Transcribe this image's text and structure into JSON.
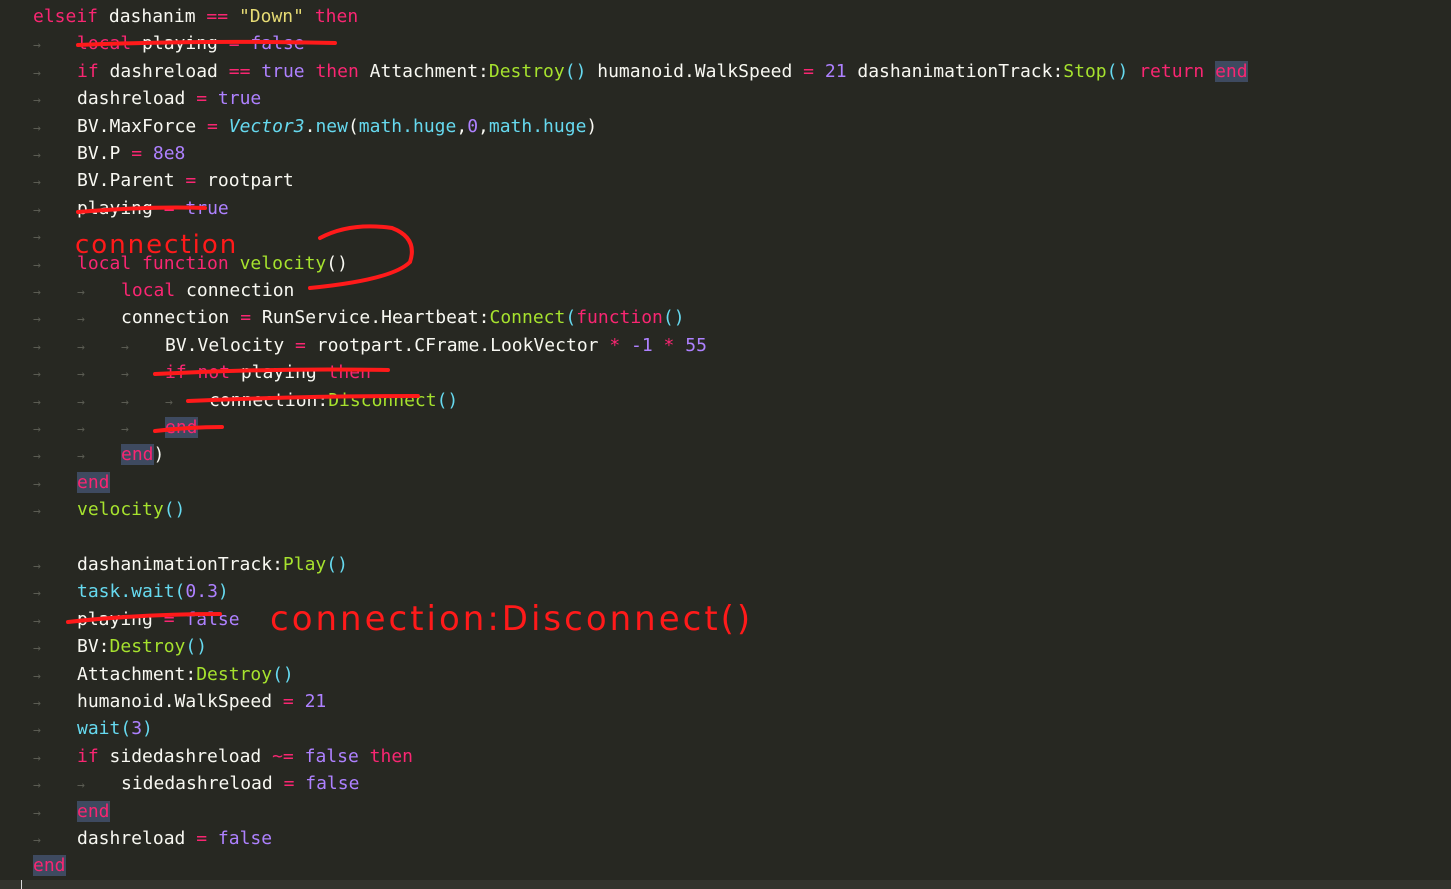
{
  "colors": {
    "background": "#272822",
    "default": "#f8f8f2",
    "keyword": "#f92672",
    "builtin": "#66d9ef",
    "function": "#a6e22e",
    "string": "#e6db74",
    "constant": "#ae81ff",
    "annotation": "#ff1a1a"
  },
  "lines": [
    {
      "indent": 0,
      "tokens": [
        [
          "elseif",
          "keyword"
        ],
        [
          " dashanim ",
          "default"
        ],
        [
          "==",
          "keyword"
        ],
        [
          " ",
          "default"
        ],
        [
          "\"Down\"",
          "string"
        ],
        [
          " ",
          "default"
        ],
        [
          "then",
          "keyword"
        ]
      ]
    },
    {
      "indent": 1,
      "tokens": [
        [
          "local",
          "keyword"
        ],
        [
          " playing ",
          "default"
        ],
        [
          "=",
          "keyword"
        ],
        [
          " ",
          "default"
        ],
        [
          "false",
          "constant"
        ]
      ]
    },
    {
      "indent": 1,
      "tokens": [
        [
          "if",
          "keyword"
        ],
        [
          " dashreload ",
          "default"
        ],
        [
          "==",
          "keyword"
        ],
        [
          " ",
          "default"
        ],
        [
          "true",
          "constant"
        ],
        [
          " ",
          "default"
        ],
        [
          "then",
          "keyword"
        ],
        [
          " Attachment:",
          "default"
        ],
        [
          "Destroy",
          "function"
        ],
        [
          "()",
          "builtin"
        ],
        [
          " humanoid.WalkSpeed ",
          "default"
        ],
        [
          "=",
          "keyword"
        ],
        [
          " ",
          "default"
        ],
        [
          "21",
          "constant"
        ],
        [
          " dashanimationTrack:",
          "default"
        ],
        [
          "Stop",
          "function"
        ],
        [
          "()",
          "builtin"
        ],
        [
          " ",
          "default"
        ],
        [
          "return",
          "keyword"
        ],
        [
          " ",
          "default"
        ],
        [
          "end",
          "keyword_hl"
        ]
      ]
    },
    {
      "indent": 1,
      "tokens": [
        [
          "dashreload ",
          "default"
        ],
        [
          "=",
          "keyword"
        ],
        [
          " ",
          "default"
        ],
        [
          "true",
          "constant"
        ]
      ]
    },
    {
      "indent": 1,
      "tokens": [
        [
          "BV.MaxForce ",
          "default"
        ],
        [
          "=",
          "keyword"
        ],
        [
          " ",
          "default"
        ],
        [
          "Vector3",
          "builtin_italic"
        ],
        [
          ".",
          "default"
        ],
        [
          "new",
          "builtin"
        ],
        [
          "(",
          "default"
        ],
        [
          "math.huge",
          "builtin"
        ],
        [
          ",",
          "default"
        ],
        [
          "0",
          "constant"
        ],
        [
          ",",
          "default"
        ],
        [
          "math.huge",
          "builtin"
        ],
        [
          ")",
          "default"
        ]
      ]
    },
    {
      "indent": 1,
      "tokens": [
        [
          "BV.P ",
          "default"
        ],
        [
          "=",
          "keyword"
        ],
        [
          " ",
          "default"
        ],
        [
          "8e8",
          "constant"
        ]
      ]
    },
    {
      "indent": 1,
      "tokens": [
        [
          "BV.Parent ",
          "default"
        ],
        [
          "=",
          "keyword"
        ],
        [
          " rootpart",
          "default"
        ]
      ]
    },
    {
      "indent": 1,
      "tokens": [
        [
          "playing ",
          "default"
        ],
        [
          "=",
          "keyword"
        ],
        [
          " ",
          "default"
        ],
        [
          "true",
          "constant"
        ]
      ]
    },
    {
      "indent": 1,
      "tokens": []
    },
    {
      "indent": 1,
      "tokens": [
        [
          "local",
          "keyword"
        ],
        [
          " ",
          "default"
        ],
        [
          "function",
          "keyword"
        ],
        [
          " ",
          "default"
        ],
        [
          "velocity",
          "function"
        ],
        [
          "()",
          "default"
        ]
      ]
    },
    {
      "indent": 2,
      "tokens": [
        [
          "local",
          "keyword"
        ],
        [
          " connection",
          "default"
        ]
      ]
    },
    {
      "indent": 2,
      "tokens": [
        [
          "connection ",
          "default"
        ],
        [
          "=",
          "keyword"
        ],
        [
          " RunService.Heartbeat:",
          "default"
        ],
        [
          "Connect",
          "function"
        ],
        [
          "(",
          "builtin"
        ],
        [
          "function",
          "keyword"
        ],
        [
          "()",
          "builtin"
        ]
      ]
    },
    {
      "indent": 3,
      "tokens": [
        [
          "BV.Velocity ",
          "default"
        ],
        [
          "=",
          "keyword"
        ],
        [
          " rootpart.CFrame.LookVector ",
          "default"
        ],
        [
          "*",
          "keyword"
        ],
        [
          " ",
          "default"
        ],
        [
          "-1",
          "constant"
        ],
        [
          " ",
          "default"
        ],
        [
          "*",
          "keyword"
        ],
        [
          " ",
          "default"
        ],
        [
          "55",
          "constant"
        ]
      ]
    },
    {
      "indent": 3,
      "tokens": [
        [
          "if",
          "keyword"
        ],
        [
          " ",
          "default"
        ],
        [
          "not",
          "keyword"
        ],
        [
          " playing ",
          "default"
        ],
        [
          "then",
          "keyword"
        ]
      ]
    },
    {
      "indent": 4,
      "tokens": [
        [
          "connection:",
          "default"
        ],
        [
          "Disconnect",
          "function"
        ],
        [
          "()",
          "builtin"
        ]
      ]
    },
    {
      "indent": 3,
      "tokens": [
        [
          "end",
          "keyword_hl"
        ]
      ]
    },
    {
      "indent": 2,
      "tokens": [
        [
          "end",
          "keyword_hl"
        ],
        [
          ")",
          "default"
        ]
      ]
    },
    {
      "indent": 1,
      "tokens": [
        [
          "end",
          "keyword_hl"
        ]
      ]
    },
    {
      "indent": 1,
      "tokens": [
        [
          "velocity",
          "function"
        ],
        [
          "()",
          "builtin"
        ]
      ]
    },
    {
      "indent": 0,
      "tokens": []
    },
    {
      "indent": 1,
      "tokens": [
        [
          "dashanimationTrack:",
          "default"
        ],
        [
          "Play",
          "function"
        ],
        [
          "()",
          "builtin"
        ]
      ]
    },
    {
      "indent": 1,
      "tokens": [
        [
          "task.wait",
          "builtin"
        ],
        [
          "(",
          "builtin"
        ],
        [
          "0.3",
          "constant"
        ],
        [
          ")",
          "builtin"
        ]
      ]
    },
    {
      "indent": 1,
      "tokens": [
        [
          "playing ",
          "default"
        ],
        [
          "=",
          "keyword"
        ],
        [
          " ",
          "default"
        ],
        [
          "false",
          "constant"
        ]
      ]
    },
    {
      "indent": 1,
      "tokens": [
        [
          "BV:",
          "default"
        ],
        [
          "Destroy",
          "function"
        ],
        [
          "()",
          "builtin"
        ]
      ]
    },
    {
      "indent": 1,
      "tokens": [
        [
          "Attachment:",
          "default"
        ],
        [
          "Destroy",
          "function"
        ],
        [
          "()",
          "builtin"
        ]
      ]
    },
    {
      "indent": 1,
      "tokens": [
        [
          "humanoid.WalkSpeed ",
          "default"
        ],
        [
          "=",
          "keyword"
        ],
        [
          " ",
          "default"
        ],
        [
          "21",
          "constant"
        ]
      ]
    },
    {
      "indent": 1,
      "tokens": [
        [
          "wait",
          "builtin"
        ],
        [
          "(",
          "builtin"
        ],
        [
          "3",
          "constant"
        ],
        [
          ")",
          "builtin"
        ]
      ]
    },
    {
      "indent": 1,
      "tokens": [
        [
          "if",
          "keyword"
        ],
        [
          " sidedashreload ",
          "default"
        ],
        [
          "~=",
          "keyword"
        ],
        [
          " ",
          "default"
        ],
        [
          "false",
          "constant"
        ],
        [
          " ",
          "default"
        ],
        [
          "then",
          "keyword"
        ]
      ]
    },
    {
      "indent": 2,
      "tokens": [
        [
          "sidedashreload ",
          "default"
        ],
        [
          "=",
          "keyword"
        ],
        [
          " ",
          "default"
        ],
        [
          "false",
          "constant"
        ]
      ]
    },
    {
      "indent": 1,
      "tokens": [
        [
          "end",
          "keyword_hl"
        ]
      ]
    },
    {
      "indent": 1,
      "tokens": [
        [
          "dashreload ",
          "default"
        ],
        [
          "=",
          "keyword"
        ],
        [
          " ",
          "default"
        ],
        [
          "false",
          "constant"
        ]
      ]
    },
    {
      "indent": 0,
      "tokens": [
        [
          "end",
          "keyword_hl"
        ]
      ]
    }
  ],
  "annotations": {
    "connection_note": "connection",
    "disconnect_note": "connection:Disconnect()"
  }
}
